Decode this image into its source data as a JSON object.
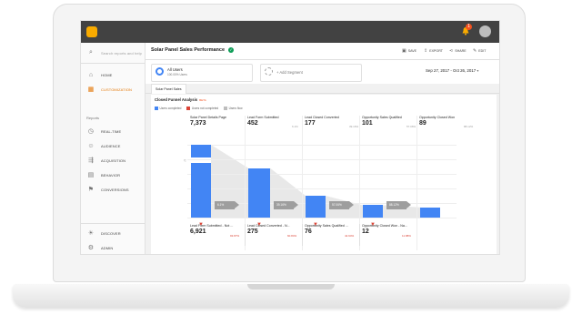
{
  "app": {
    "title": "Solar Panel Sales Performance",
    "notification_count": "1",
    "toolbar": {
      "save": "SAVE",
      "export": "EXPORT",
      "share": "SHARE",
      "edit": "EDIT"
    }
  },
  "sidebar": {
    "search_placeholder": "Search reports and help",
    "items_top": [
      {
        "label": "HOME",
        "icon": "home-icon",
        "glyph": "⌂"
      },
      {
        "label": "CUSTOMIZATION",
        "icon": "customization-icon",
        "glyph": "▦"
      }
    ],
    "reports_heading": "Reports",
    "items_reports": [
      {
        "label": "REAL-TIME",
        "icon": "clock-icon",
        "glyph": "◷"
      },
      {
        "label": "AUDIENCE",
        "icon": "person-icon",
        "glyph": "☺"
      },
      {
        "label": "ACQUISITION",
        "icon": "acquisition-icon",
        "glyph": "⇶"
      },
      {
        "label": "BEHAVIOR",
        "icon": "behavior-icon",
        "glyph": "▤"
      },
      {
        "label": "CONVERSIONS",
        "icon": "flag-icon",
        "glyph": "⚑"
      }
    ],
    "items_bottom": [
      {
        "label": "DISCOVER",
        "icon": "lightbulb-icon",
        "glyph": "☀"
      },
      {
        "label": "ADMIN",
        "icon": "gear-icon",
        "glyph": "⚙"
      }
    ]
  },
  "segments": {
    "active": {
      "name": "All Users",
      "sub": "100.00% Users"
    },
    "add_label": "+ Add Segment"
  },
  "date_range": "Sep 27, 2017 - Oct 26, 2017",
  "tabs": [
    "Solar Panel Sales"
  ],
  "panel": {
    "title": "Closed Funnel Analysis",
    "beta": "BETA",
    "legend": [
      {
        "label": "Users completed",
        "color": "#4285f4"
      },
      {
        "label": "Users not completed",
        "color": "#db4437"
      },
      {
        "label": "Users flow",
        "color": "#bdbdbd"
      }
    ]
  },
  "chart_data": {
    "type": "bar",
    "title": "Closed Funnel Analysis",
    "y_ticks": [
      "",
      "",
      "",
      "",
      "",
      ""
    ],
    "steps": [
      {
        "name": "Solar Panel Details Page",
        "value": "7,373",
        "pct": "",
        "completed": 7373
      },
      {
        "name": "Lead Form Submitted",
        "value": "452",
        "pct": "6.1%",
        "completed": 452
      },
      {
        "name": "Lead Closed Converted",
        "value": "177",
        "pct": "39.16%",
        "completed": 177
      },
      {
        "name": "Opportunity Sales Qualified",
        "value": "101",
        "pct": "57.06%",
        "completed": 101
      },
      {
        "name": "Opportunity Closed Won",
        "value": "89",
        "pct": "88.12%",
        "completed": 89
      }
    ],
    "bar_heights_relative": [
      1.0,
      0.68,
      0.3,
      0.17,
      0.14
    ],
    "flow_labels": [
      "6.1%",
      "39.16%",
      "57.06%",
      "88.12%"
    ],
    "exits": [
      {
        "name": "Lead Form Submitted - Not ...",
        "value": "6,921",
        "pct": "93.87%"
      },
      {
        "name": "Lead Closed Converted - N...",
        "value": "275",
        "pct": "60.84%"
      },
      {
        "name": "Opportunity Sales Qualified ...",
        "value": "76",
        "pct": "42.94%"
      },
      {
        "name": "Opportunity Closed Won - Na...",
        "value": "12",
        "pct": "11.88%"
      }
    ]
  }
}
